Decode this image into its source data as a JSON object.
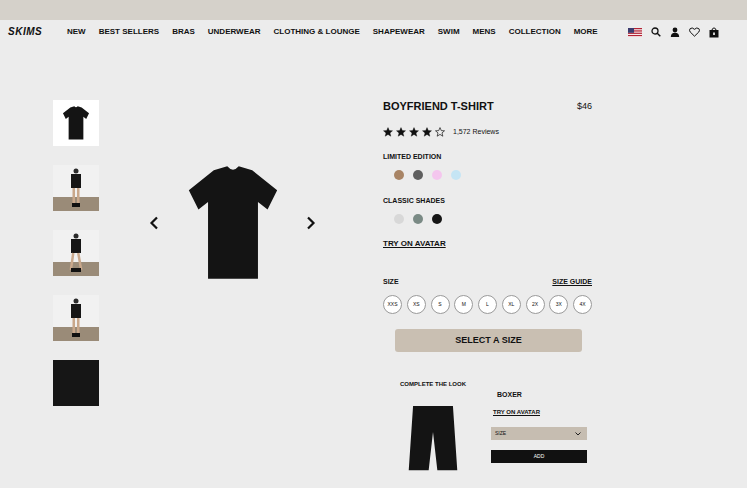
{
  "logo": "SKIMS",
  "nav": [
    "NEW",
    "BEST SELLERS",
    "BRAS",
    "UNDERWEAR",
    "CLOTHING & LOUNGE",
    "SHAPEWEAR",
    "SWIM",
    "MENS",
    "COLLECTION",
    "MORE"
  ],
  "product": {
    "title": "BOYFRIEND T-SHIRT",
    "price": "$46",
    "stars": 4,
    "reviews": "1,572 Reviews",
    "color_groups": [
      {
        "label": "LIMITED EDITION",
        "swatches": [
          {
            "color": "#a88465",
            "selected": false
          },
          {
            "color": "#5f5f5f",
            "selected": false
          },
          {
            "color": "#f4c6ee",
            "selected": false
          },
          {
            "color": "#c5e5f4",
            "selected": false
          }
        ]
      },
      {
        "label": "CLASSIC SHADES",
        "swatches": [
          {
            "color": "#d8d8d8",
            "selected": false
          },
          {
            "color": "#7a8a85",
            "selected": false
          },
          {
            "color": "#151515",
            "selected": false
          }
        ]
      }
    ],
    "try_on": "TRY ON AVATAR",
    "size_label": "SIZE",
    "size_guide": "SIZE GUIDE",
    "sizes": [
      {
        "label": "XXS",
        "selected": false
      },
      {
        "label": "XS",
        "selected": false
      },
      {
        "label": "S",
        "selected": false
      },
      {
        "label": "M",
        "selected": false
      },
      {
        "label": "L",
        "selected": false
      },
      {
        "label": "XL",
        "selected": false
      },
      {
        "label": "2X",
        "selected": false
      },
      {
        "label": "3X",
        "selected": false
      },
      {
        "label": "4X",
        "selected": false
      }
    ],
    "cta": "SELECT A SIZE"
  },
  "complete_the_look": {
    "title": "COMPLETE THE LOOK",
    "item": {
      "name": "BOXER",
      "try_on": "TRY ON AVATAR",
      "size_select": "SIZE",
      "add": "ADD"
    }
  }
}
